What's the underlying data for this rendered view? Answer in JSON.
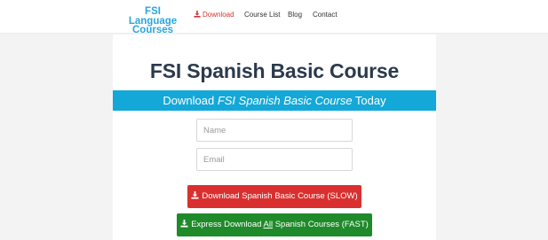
{
  "header": {
    "logo_line1": "FSI Language",
    "logo_line2": "Courses",
    "nav": {
      "download": "Download",
      "course_list": "Course List",
      "blog": "Blog",
      "contact": "Contact"
    }
  },
  "main": {
    "title": "FSI Spanish Basic Course",
    "banner": {
      "prefix": "Download ",
      "course": "FSI Spanish Basic Course",
      "suffix": " Today"
    },
    "form": {
      "name_placeholder": "Name",
      "email_placeholder": "Email"
    },
    "buttons": {
      "slow_label": "Download Spanish Basic Course (SLOW)",
      "fast_prefix": "Express Download ",
      "fast_underlined": "All",
      "fast_suffix": " Spanish Courses (FAST)"
    }
  },
  "colors": {
    "brand_blue": "#29a6db",
    "banner_blue": "#14a8d8",
    "download_red": "#d9302f",
    "express_green": "#1f8a2a",
    "title_dark": "#2c3a4d"
  },
  "icons": [
    "download-icon"
  ]
}
